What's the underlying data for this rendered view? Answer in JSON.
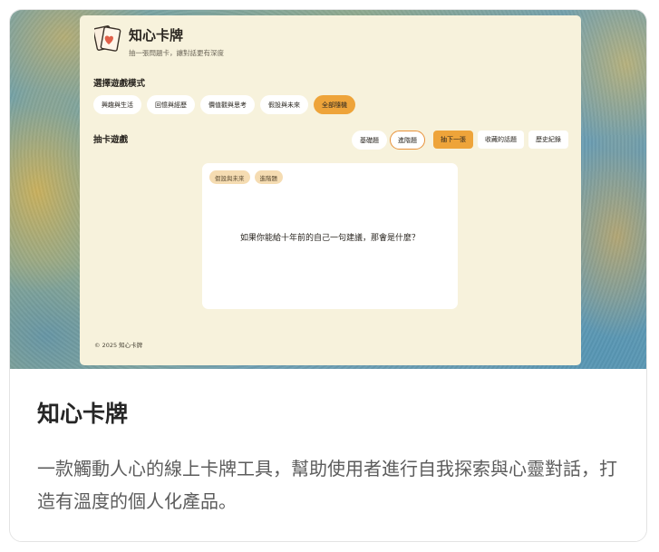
{
  "app": {
    "title": "知心卡牌",
    "subtitle": "抽一張問題卡，讓對話更有深度",
    "mode_section_label": "選擇遊戲模式",
    "modes": [
      {
        "label": "興趣與生活",
        "active": false
      },
      {
        "label": "回憶與經歷",
        "active": false
      },
      {
        "label": "價值觀與思考",
        "active": false
      },
      {
        "label": "假設與未來",
        "active": false
      },
      {
        "label": "全部隨機",
        "active": true
      }
    ],
    "game_section_label": "抽卡遊戲",
    "difficulties": [
      {
        "label": "基礎題",
        "selected": false
      },
      {
        "label": "進階題",
        "selected": true
      }
    ],
    "actions": {
      "draw_next": "抽下一張",
      "saved_topics": "收藏的話題",
      "history": "歷史紀錄"
    },
    "card": {
      "tags": [
        "假設與未來",
        "進階題"
      ],
      "question": "如果你能給十年前的自己一句建議，那會是什麼？"
    },
    "footer": "© 2025 知心卡牌",
    "colors": {
      "accent": "#eea43a",
      "panel": "#f7f2dc"
    }
  },
  "project": {
    "title": "知心卡牌",
    "description": "一款觸動人心的線上卡牌工具，幫助使用者進行自我探索與心靈對話，打造有溫度的個人化產品。"
  }
}
